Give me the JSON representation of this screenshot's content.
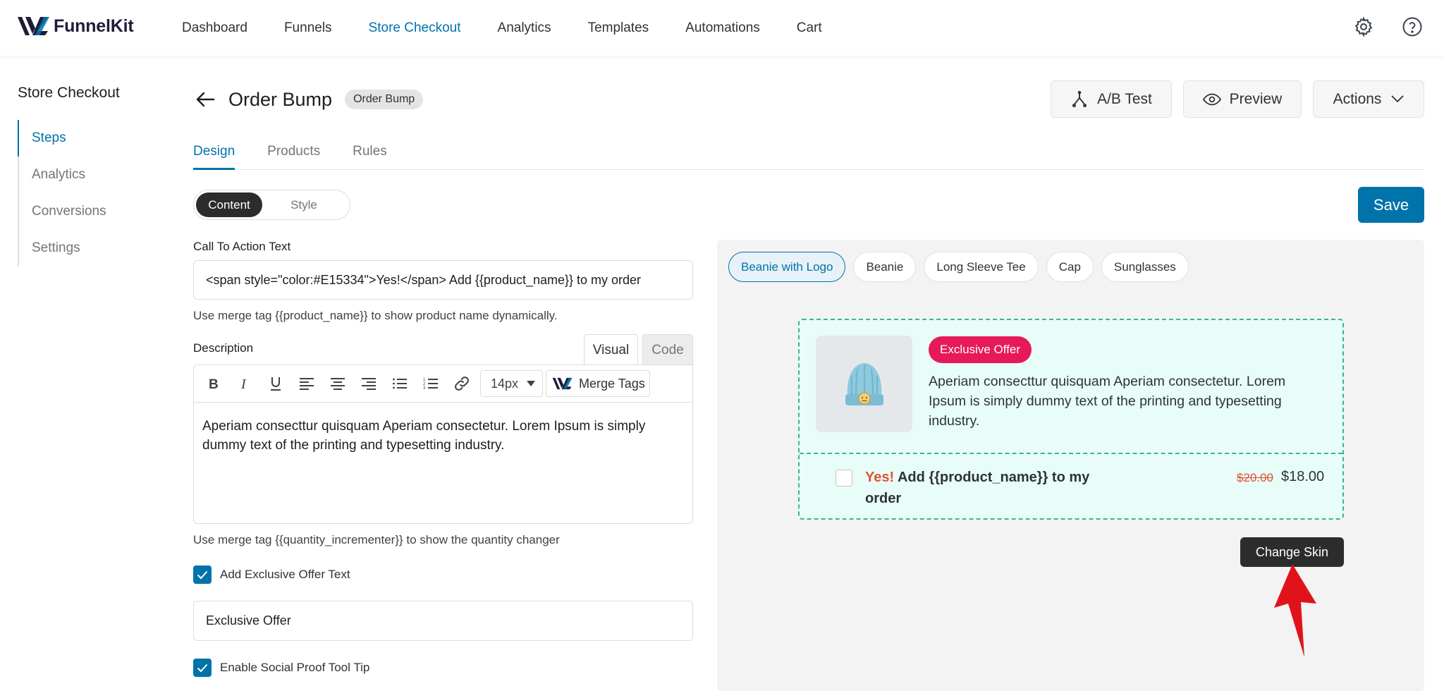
{
  "brand": {
    "name": "FunnelKit",
    "accent": "#0073aa"
  },
  "nav": {
    "items": [
      "Dashboard",
      "Funnels",
      "Store Checkout",
      "Analytics",
      "Templates",
      "Automations",
      "Cart"
    ],
    "active": "Store Checkout"
  },
  "icons": {
    "settings": "gear-icon",
    "help": "question-circle-icon"
  },
  "sidebar": {
    "title": "Store Checkout",
    "items": [
      "Steps",
      "Analytics",
      "Conversions",
      "Settings"
    ],
    "active": "Steps"
  },
  "header": {
    "title": "Order Bump",
    "badge": "Order Bump",
    "ab_label": "A/B Test",
    "preview_label": "Preview",
    "actions_label": "Actions"
  },
  "tabs": [
    "Design",
    "Products",
    "Rules"
  ],
  "mode_toggle": {
    "content": "Content",
    "style": "Style"
  },
  "save_label": "Save",
  "form": {
    "cta_label": "Call To Action Text",
    "cta_value": "<span style=\"color:#E15334\">Yes!</span> Add {{product_name}} to my order",
    "cta_hint": "Use merge tag {{product_name}} to show product name dynamically.",
    "desc_label": "Description",
    "editor_tabs": {
      "visual": "Visual",
      "code": "Code"
    },
    "font_size": "14px",
    "merge_tags_label": "Merge Tags",
    "desc_value": "Aperiam consecttur quisquam Aperiam consectetur. Lorem Ipsum is simply dummy text of the printing and typesetting industry.",
    "desc_hint": "Use merge tag {{quantity_incrementer}} to show the quantity changer",
    "exclusive_cb_label": "Add Exclusive Offer Text",
    "exclusive_cb_checked": true,
    "exclusive_value": "Exclusive Offer",
    "social_cb_label": "Enable Social Proof Tool Tip",
    "social_cb_checked": true
  },
  "preview": {
    "products": [
      "Beanie with Logo",
      "Beanie",
      "Long Sleeve Tee",
      "Cap",
      "Sunglasses"
    ],
    "active_product": "Beanie with Logo",
    "badge": "Exclusive Offer",
    "description": "Aperiam consecttur quisquam Aperiam consectetur. Lorem Ipsum is simply dummy text of the printing and typesetting industry.",
    "cta_yes": "Yes!",
    "cta_rest": "Add {{product_name}} to my order",
    "price_old": "$20.00",
    "price_new": "$18.00",
    "change_skin_label": "Change Skin"
  }
}
